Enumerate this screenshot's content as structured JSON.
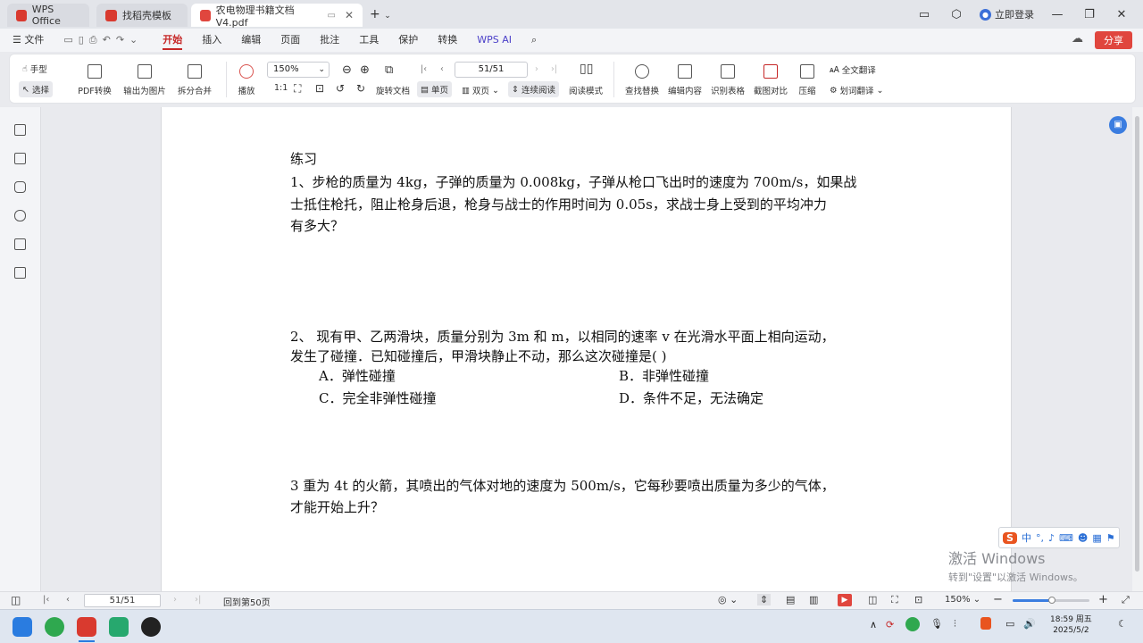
{
  "tabs": [
    {
      "label": "WPS Office",
      "color": "#d93a2f"
    },
    {
      "label": "找稻壳模板",
      "color": "#d93a2f"
    },
    {
      "label": "农电物理书籍文档V4.pdf",
      "color": "#e0463e"
    }
  ],
  "titlebar": {
    "login_label": "立即登录"
  },
  "menu": {
    "file": "文件",
    "items": [
      "开始",
      "插入",
      "编辑",
      "页面",
      "批注",
      "工具",
      "保护",
      "转换",
      "WPS AI"
    ],
    "share": "分享"
  },
  "toolbar": {
    "hand": "手型",
    "select": "选择",
    "pdf_convert": "PDF转换",
    "export_image": "输出为图片",
    "split_merge": "拆分合并",
    "play": "播放",
    "zoom": "150%",
    "page": "51/51",
    "rotate": "旋转文档",
    "single": "单页",
    "double": "双页",
    "continuous": "连续阅读",
    "read_mode": "阅读模式",
    "find_replace": "查找替换",
    "edit_content": "编辑内容",
    "recognize_table": "识别表格",
    "screenshot_compare": "截图对比",
    "compress": "压缩",
    "full_translate": "全文翻译",
    "word_translate": "划词翻译"
  },
  "document": {
    "heading": "练习",
    "q1": [
      "1、步枪的质量为 4kg，子弹的质量为 0.008kg，子弹从枪口飞出时的速度为 700m/s，如果战",
      "士抵住枪托，阻止枪身后退，枪身与战士的作用时间为 0.05s，求战士身上受到的平均冲力",
      "有多大？"
    ],
    "q2": [
      "2、 现有甲、乙两滑块，质量分别为 3m 和 m，以相同的速率 v 在光滑水平面上相向运动，",
      "发生了碰撞．已知碰撞后，甲滑块静止不动，那么这次碰撞是(      )"
    ],
    "q2_options": [
      "A．弹性碰撞",
      "B．非弹性碰撞",
      "C．完全非弹性碰撞",
      "D．条件不足，无法确定"
    ],
    "q3": [
      "3 重为 4t 的火箭，其喷出的气体对地的速度为 500m/s，它每秒要喷出质量为多少的气体，",
      "才能开始上升？"
    ]
  },
  "statusbar": {
    "page": "51/51",
    "back_label": "回到第50页",
    "zoom": "150%"
  },
  "watermark": {
    "line1": "激活 Windows",
    "line2": "转到\"设置\"以激活 Windows。"
  },
  "ime": {
    "label": "中"
  },
  "clock": {
    "time": "18:59 周五",
    "date": "2025/5/2"
  },
  "colors": {
    "accent": "#c62828",
    "share": "#e0463e",
    "taskbar": "#dfe6f0"
  }
}
